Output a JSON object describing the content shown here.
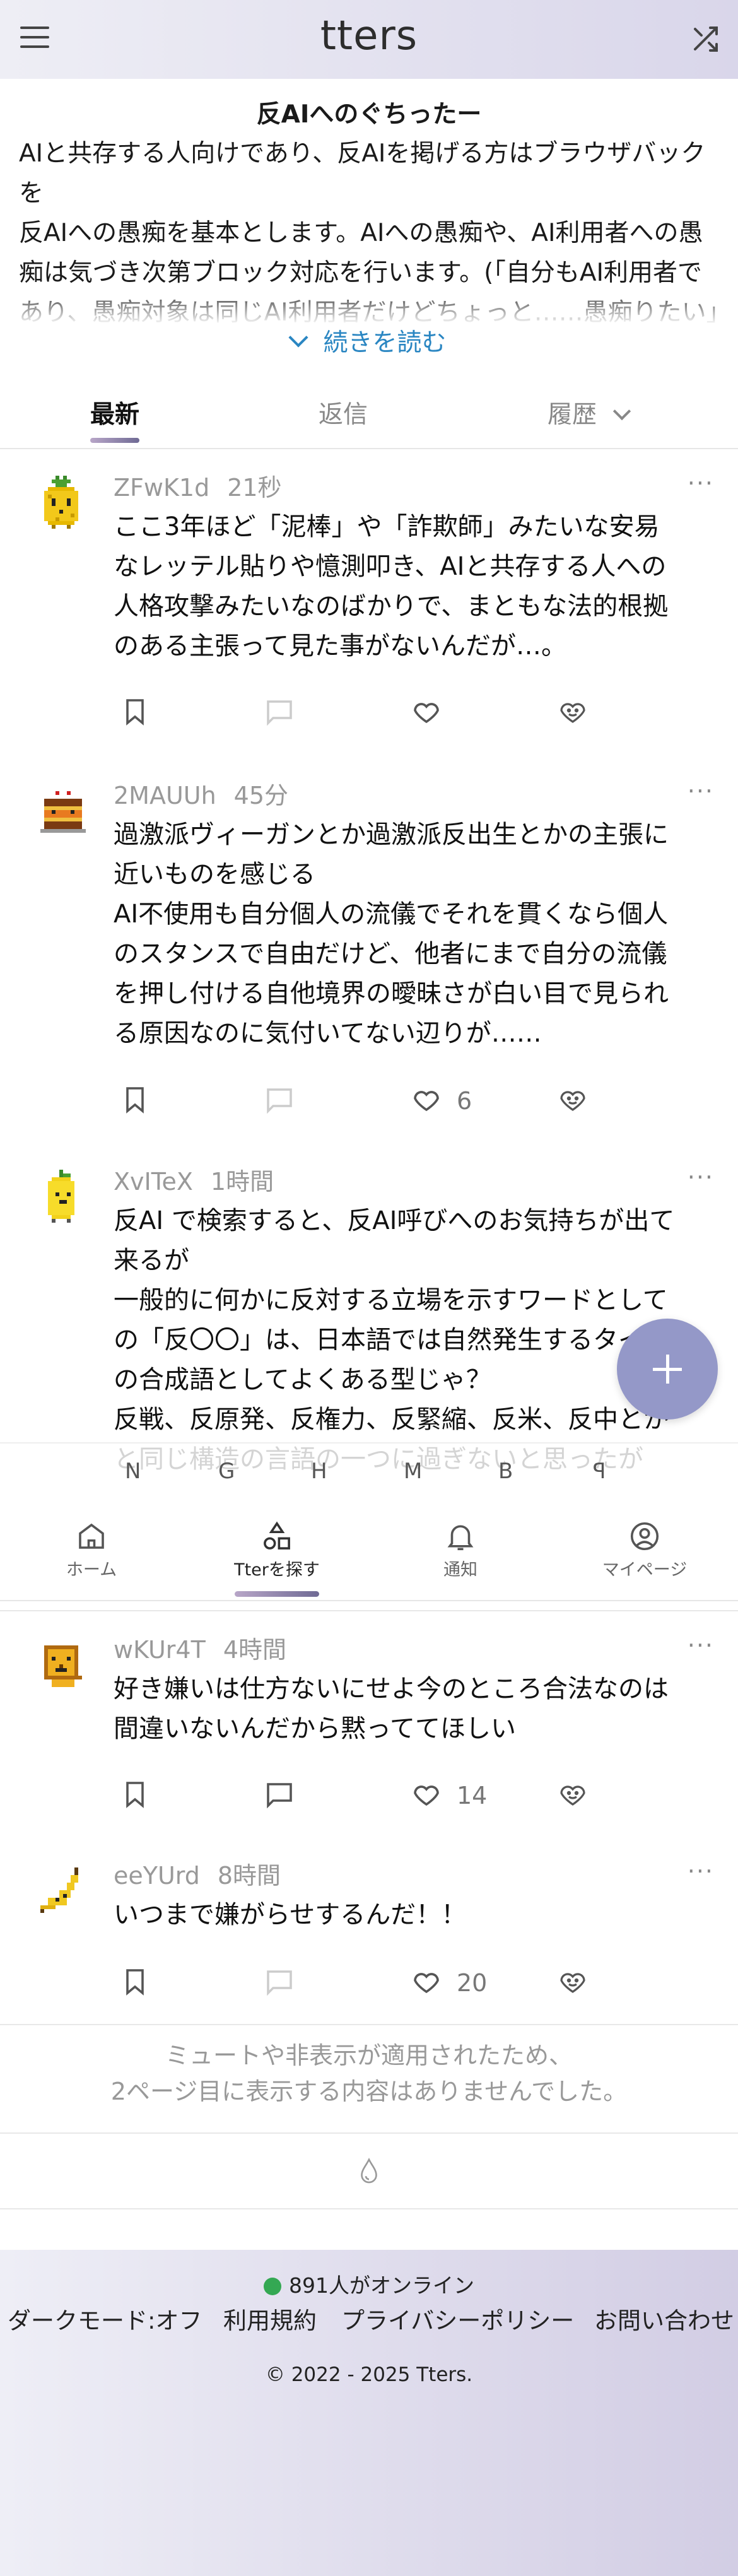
{
  "header": {
    "logo": "tters",
    "menu_icon": "hamburger-icon",
    "shuffle_icon": "shuffle-icon"
  },
  "board": {
    "title": "反AIへのぐちったー",
    "description": "AIと共存する人向けであり、反AIを掲げる方はブラウザバックを\n反AIへの愚痴を基本とします。AIへの愚痴や、AI利用者への愚痴は気づき次第ブロック対応を行います。(「自分もAI利用者であり、愚痴対象は同じAI利用者だけどちょっと……愚痴りたい」程度のものはOK)",
    "read_more": "続きを読む"
  },
  "tabs": {
    "latest": "最新",
    "replies": "返信",
    "history": "履歴"
  },
  "posts": [
    {
      "user": "ZFwK1d",
      "time": "21秒",
      "text": "ここ3年ほど「泥棒」や「詐欺師」みたいな安易なレッテル貼りや憶測叩き、AIと共存する人への人格攻撃みたいなのばかりで、まともな法的根拠のある主張って見た事がないんだが…。",
      "likes": "",
      "avatar": "pineapple-avatar"
    },
    {
      "user": "2MAUUh",
      "time": "45分",
      "text": "過激派ヴィーガンとか過激派反出生とかの主張に近いものを感じる\nAI不使用も自分個人の流儀でそれを貫くなら個人のスタンスで自由だけど、他者にまで自分の流儀を押し付ける自他境界の曖昧さが白い目で見られる原因なのに気付いてない辺りが……",
      "likes": "6",
      "avatar": "cake-avatar"
    },
    {
      "user": "XvITeX",
      "time": "1時間",
      "text": "反AI で検索すると、反AI呼びへのお気持ちが出て来るが\n一般的に何かに反対する立場を示すワードとしての「反〇〇」は、日本語では自然発生するタイプの合成語としてよくある型じゃ？\n反戦、反原発、反権力、反緊縮、反米、反中とかと同じ構造の言語の一つに過ぎないと思ったが",
      "likes": "",
      "avatar": "lemon-avatar"
    },
    {
      "user": "wKUr4T",
      "time": "4時間",
      "text": "好き嫌いは仕方ないにせよ今のところ合法なのは間違いないんだから黙っててほしい",
      "likes": "14",
      "avatar": "lion-avatar"
    },
    {
      "user": "eeYUrd",
      "time": "8時間",
      "text": "いつまで嫌がらせするんだ！！",
      "likes": "20",
      "avatar": "banana-avatar"
    }
  ],
  "overlay_strip": [
    "N",
    "G",
    "H",
    "M",
    "B",
    "ꟼ"
  ],
  "bottom_nav": {
    "home": "ホーム",
    "explore": "Tterを探す",
    "notifications": "通知",
    "mypage": "マイページ"
  },
  "end_message": "ミュートや非表示が適用されたため、\n2ページ目に表示する内容はありませんでした。",
  "footer": {
    "online": "891人がオンライン",
    "dark_mode": "ダークモード:オフ",
    "terms": "利用規約",
    "privacy": "プライバシーポリシー",
    "contact": "お問い合わせ",
    "copyright": "© 2022 - 2025 Tters."
  },
  "colors": {
    "accent": "#2a86c2",
    "fab": "#9498c8",
    "online": "#34a853"
  }
}
